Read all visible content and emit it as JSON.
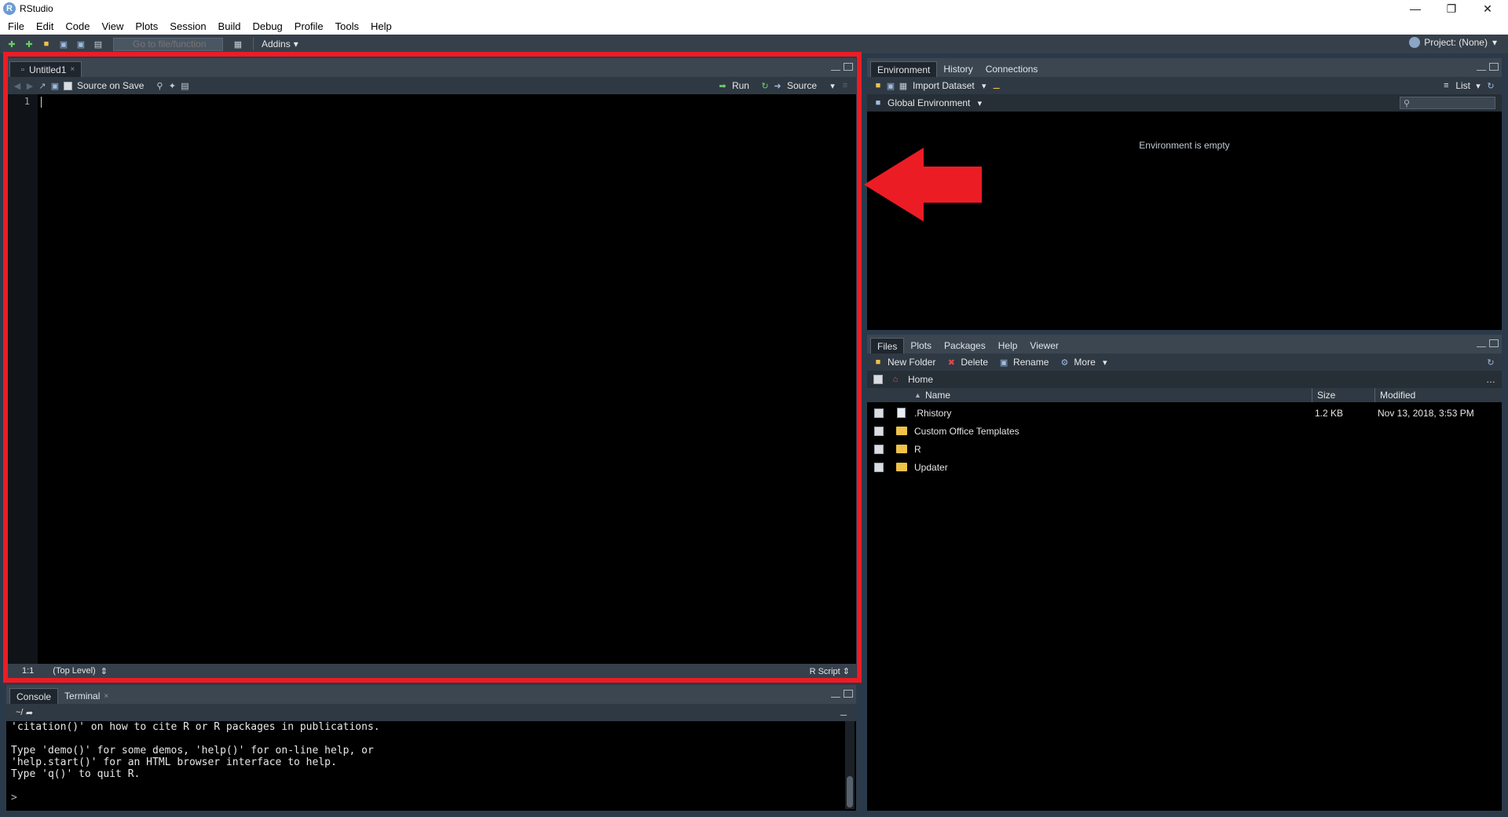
{
  "window": {
    "title": "RStudio",
    "logo_letter": "R"
  },
  "menubar": {
    "items": [
      "File",
      "Edit",
      "Code",
      "View",
      "Plots",
      "Session",
      "Build",
      "Debug",
      "Profile",
      "Tools",
      "Help"
    ]
  },
  "toolbar": {
    "goto_placeholder": "Go to file/function",
    "addins_label": "Addins",
    "project_label": "Project: (None)"
  },
  "editor": {
    "tab_label": "Untitled1",
    "source_on_save_label": "Source on Save",
    "run_label": "Run",
    "source_label": "Source",
    "line_number": "1",
    "position": "1:1",
    "scope": "(Top Level)",
    "file_type": "R Script"
  },
  "console": {
    "tabs": [
      "Console",
      "Terminal"
    ],
    "path": "~/",
    "lines": [
      "'citation()' on how to cite R or R packages in publications.",
      "",
      "Type 'demo()' for some demos, 'help()' for on-line help, or",
      "'help.start()' for an HTML browser interface to help.",
      "Type 'q()' to quit R.",
      "",
      "> "
    ]
  },
  "environment": {
    "tabs": [
      "Environment",
      "History",
      "Connections"
    ],
    "import_label": "Import Dataset",
    "list_label": "List",
    "scope_label": "Global Environment",
    "empty_message": "Environment is empty"
  },
  "files": {
    "tabs": [
      "Files",
      "Plots",
      "Packages",
      "Help",
      "Viewer"
    ],
    "new_folder_label": "New Folder",
    "delete_label": "Delete",
    "rename_label": "Rename",
    "more_label": "More",
    "breadcrumb": "Home",
    "columns": {
      "name": "Name",
      "size": "Size",
      "modified": "Modified"
    },
    "rows": [
      {
        "name": ".Rhistory",
        "size": "1.2 KB",
        "modified": "Nov 13, 2018, 3:53 PM",
        "kind": "file"
      },
      {
        "name": "Custom Office Templates",
        "size": "",
        "modified": "",
        "kind": "folder"
      },
      {
        "name": "R",
        "size": "",
        "modified": "",
        "kind": "folder"
      },
      {
        "name": "Updater",
        "size": "",
        "modified": "",
        "kind": "folder"
      }
    ]
  },
  "annotation": {
    "highlight_color": "#ec1c24"
  }
}
